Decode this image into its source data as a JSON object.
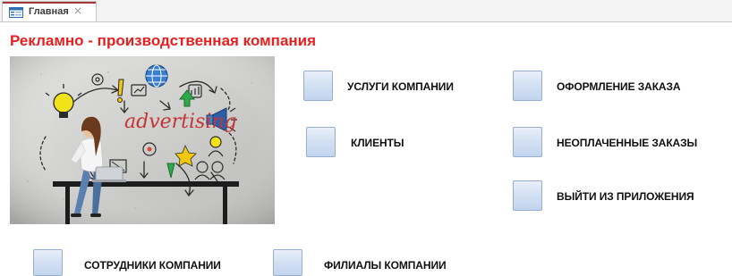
{
  "tab": {
    "label": "Главная",
    "icon": "form-icon",
    "close_icon": "close-icon",
    "close_glyph": "×",
    "accent_color": "#a4373a"
  },
  "page": {
    "title": "Рекламно - производственная компания",
    "title_color": "#e81f1f"
  },
  "illustration": {
    "icon": "advertising-image",
    "text": "advertising"
  },
  "buttons": {
    "services": "УСЛУГИ КОМПАНИИ",
    "clients": "КЛИЕНТЫ",
    "order": "ОФОРМЛЕНИЕ ЗАКАЗА",
    "unpaid": "НЕОПЛАЧЕННЫЕ ЗАКАЗЫ",
    "exit": "ВЫЙТИ ИЗ ПРИЛОЖЕНИЯ",
    "employees": "СОТРУДНИКИ КОМПАНИИ",
    "branches": "ФИЛИАЛЫ КОМПАНИИ"
  }
}
